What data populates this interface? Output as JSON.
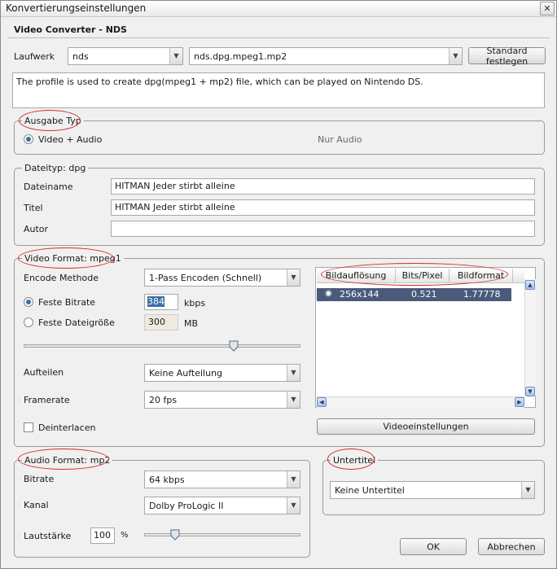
{
  "window": {
    "title": "Konvertierungseinstellungen",
    "close_glyph": "✕"
  },
  "header": {
    "title": "Video Converter - NDS"
  },
  "drive": {
    "label": "Laufwerk",
    "device_value": "nds",
    "profile_value": "nds.dpg.mpeg1.mp2",
    "default_button": "Standard festlegen"
  },
  "description": "The profile is used to create dpg(mpeg1 + mp2) file, which can be played on Nintendo DS.",
  "output_type": {
    "legend": "Ausgabe Typ",
    "option_video_audio": "Video + Audio",
    "option_audio_only": "Nur Audio",
    "selected": "Video + Audio"
  },
  "file_type": {
    "legend": "Dateityp: dpg",
    "filename_label": "Dateiname",
    "filename_value": "HITMAN Jeder stirbt alleine",
    "title_label": "Titel",
    "title_value": "HITMAN Jeder stirbt alleine",
    "author_label": "Autor",
    "author_value": ""
  },
  "video_format": {
    "legend": "Video Format: mpeg1",
    "encode_label": "Encode Methode",
    "encode_value": "1-Pass Encoden (Schnell)",
    "fixed_bitrate_label": "Feste Bitrate",
    "bitrate_value": "384",
    "bitrate_unit": "kbps",
    "fixed_size_label": "Feste Dateigröße",
    "size_value": "300",
    "size_unit": "MB",
    "bitrate_slider_level": 0.76,
    "split_label": "Aufteilen",
    "split_value": "Keine Aufteilung",
    "framerate_label": "Framerate",
    "framerate_value": "20 fps",
    "deinterlace_label": "Deinterlacen",
    "deinterlace_checked": false,
    "resolution_list": {
      "columns": [
        "Bildauflösung",
        "Bits/Pixel",
        "Bildformat"
      ],
      "rows": [
        {
          "resolution": "256x144",
          "bits_per_pixel": "0.521",
          "aspect": "1.77778",
          "selected": true
        }
      ]
    },
    "video_settings_button": "Videoeinstellungen"
  },
  "audio_format": {
    "legend": "Audio Format: mp2",
    "bitrate_label": "Bitrate",
    "bitrate_value": "64 kbps",
    "channel_label": "Kanal",
    "channel_value": "Dolby ProLogic II",
    "volume_label": "Lautstärke",
    "volume_value": "100",
    "volume_unit": "%",
    "volume_slider_level": 0.2
  },
  "subtitle": {
    "legend": "Untertitel",
    "value": "Keine Untertitel"
  },
  "buttons": {
    "ok": "OK",
    "cancel": "Abbrechen"
  },
  "colors": {
    "highlight_oval": "#d42a2a",
    "selected_row": "#4a5a7a",
    "radio_dot": "#3a6ea8"
  }
}
